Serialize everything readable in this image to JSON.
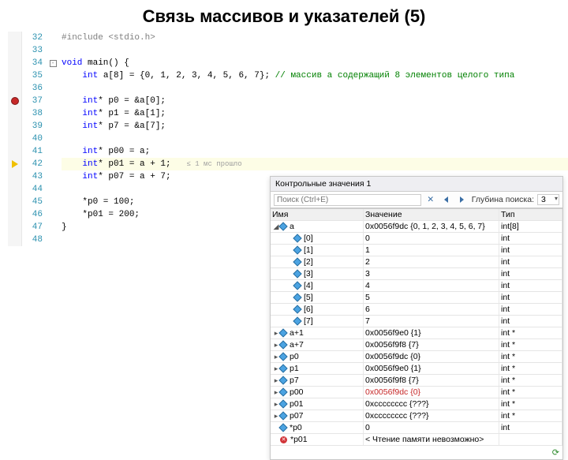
{
  "title": "Связь массивов и указателей (5)",
  "lines": {
    "start": 32,
    "end": 48
  },
  "code": {
    "l32_pre": "#include ",
    "l32_inc": "<stdio.h>",
    "l34_a": "void",
    "l34_b": " main() {",
    "l35_a": "    ",
    "l35_kw": "int",
    "l35_b": " a[8] = {0, 1, 2, 3, 4, 5, 6, 7}; ",
    "l35_cm": "// массив a содержащий 8 элементов целого типа",
    "l37_a": "    ",
    "l37_kw": "int",
    "l37_b": "* p0 = &a[0];",
    "l38_a": "    ",
    "l38_kw": "int",
    "l38_b": "* p1 = &a[1];",
    "l39_a": "    ",
    "l39_kw": "int",
    "l39_b": "* p7 = &a[7];",
    "l41_a": "    ",
    "l41_kw": "int",
    "l41_b": "* p00 = a;",
    "l42_a": "    ",
    "l42_kw": "int",
    "l42_b": "* p01 = a + 1;   ",
    "l42_lens": "≤ 1 мс прошло",
    "l43_a": "    ",
    "l43_kw": "int",
    "l43_b": "* p07 = a + 7;",
    "l45": "    *p0 = 100;",
    "l46": "    *p01 = 200;",
    "l47": "}"
  },
  "watch": {
    "title": "Контрольные значения 1",
    "search_ph": "Поиск (Ctrl+E)",
    "depth_label": "Глубина поиска:",
    "depth_val": "3",
    "cols": {
      "name": "Имя",
      "value": "Значение",
      "type": "Тип"
    },
    "rows": [
      {
        "tw": "◢",
        "ind": 0,
        "name": "a",
        "value": "0x0056f9dc {0, 1, 2, 3, 4, 5, 6, 7}",
        "type": "int[8]"
      },
      {
        "tw": "",
        "ind": 2,
        "name": "[0]",
        "value": "0",
        "type": "int"
      },
      {
        "tw": "",
        "ind": 2,
        "name": "[1]",
        "value": "1",
        "type": "int"
      },
      {
        "tw": "",
        "ind": 2,
        "name": "[2]",
        "value": "2",
        "type": "int"
      },
      {
        "tw": "",
        "ind": 2,
        "name": "[3]",
        "value": "3",
        "type": "int"
      },
      {
        "tw": "",
        "ind": 2,
        "name": "[4]",
        "value": "4",
        "type": "int"
      },
      {
        "tw": "",
        "ind": 2,
        "name": "[5]",
        "value": "5",
        "type": "int"
      },
      {
        "tw": "",
        "ind": 2,
        "name": "[6]",
        "value": "6",
        "type": "int"
      },
      {
        "tw": "",
        "ind": 2,
        "name": "[7]",
        "value": "7",
        "type": "int"
      },
      {
        "tw": "▸",
        "ind": 0,
        "name": "a+1",
        "value": "0x0056f9e0 {1}",
        "type": "int *"
      },
      {
        "tw": "▸",
        "ind": 0,
        "name": "a+7",
        "value": "0x0056f9f8 {7}",
        "type": "int *"
      },
      {
        "tw": "▸",
        "ind": 0,
        "name": "p0",
        "value": "0x0056f9dc {0}",
        "type": "int *"
      },
      {
        "tw": "▸",
        "ind": 0,
        "name": "p1",
        "value": "0x0056f9e0 {1}",
        "type": "int *"
      },
      {
        "tw": "▸",
        "ind": 0,
        "name": "p7",
        "value": "0x0056f9f8 {7}",
        "type": "int *"
      },
      {
        "tw": "▸",
        "ind": 0,
        "name": "p00",
        "value": "0x0056f9dc {0}",
        "type": "int *",
        "red": true
      },
      {
        "tw": "▸",
        "ind": 0,
        "name": "p01",
        "value": "0xcccccccc {???}",
        "type": "int *"
      },
      {
        "tw": "▸",
        "ind": 0,
        "name": "p07",
        "value": "0xcccccccc {???}",
        "type": "int *"
      },
      {
        "tw": "",
        "ind": 0,
        "name": "*p0",
        "value": "0",
        "type": "int"
      },
      {
        "tw": "",
        "ind": 0,
        "name": "*p01",
        "value": "< Чтение памяти невозможно>",
        "type": "",
        "err": true
      }
    ]
  }
}
